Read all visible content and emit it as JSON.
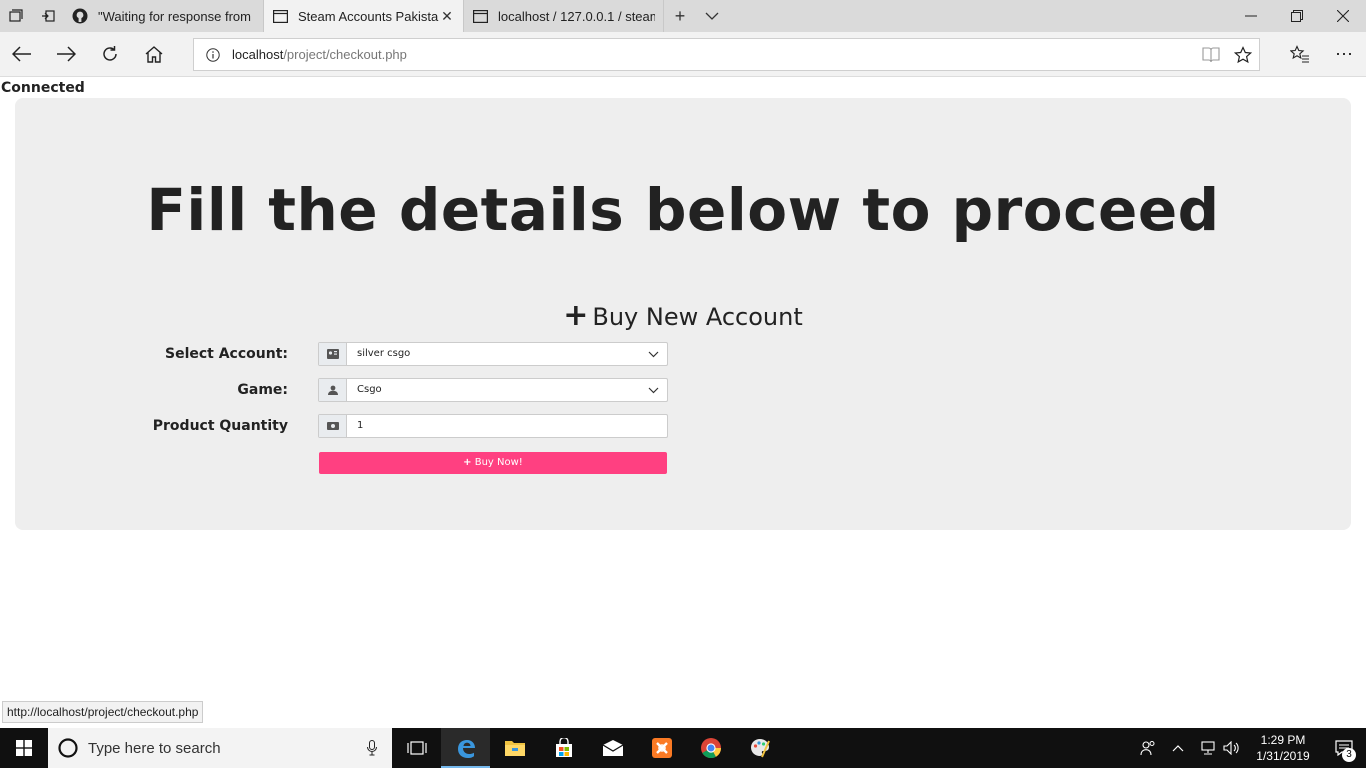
{
  "browser": {
    "tabs": [
      {
        "title": "\"Waiting for response from",
        "favicon": "github-icon",
        "active": false
      },
      {
        "title": "Steam Accounts Pakista",
        "favicon": "page-icon",
        "active": true
      },
      {
        "title": "localhost / 127.0.0.1 / steam",
        "favicon": "page-icon",
        "active": false
      }
    ],
    "url_host": "localhost",
    "url_path": "/project/checkout.php",
    "status_url": "http://localhost/project/checkout.php"
  },
  "page": {
    "connected": "Connected",
    "headline": "Fill the details below to proceed",
    "form_title": "Buy New Account",
    "fields": [
      {
        "label": "Select Account:",
        "value": "silver csgo",
        "icon": "id-card-icon",
        "dropdown": true
      },
      {
        "label": "Game:",
        "value": "Csgo",
        "icon": "user-icon",
        "dropdown": true
      },
      {
        "label": "Product Quantity",
        "value": "1",
        "icon": "money-icon",
        "dropdown": false
      }
    ],
    "buy_button": "Buy Now!",
    "buy_color": "#ff4081"
  },
  "taskbar": {
    "search_placeholder": "Type here to search",
    "time": "1:29 PM",
    "date": "1/31/2019",
    "notification_count": "3"
  }
}
